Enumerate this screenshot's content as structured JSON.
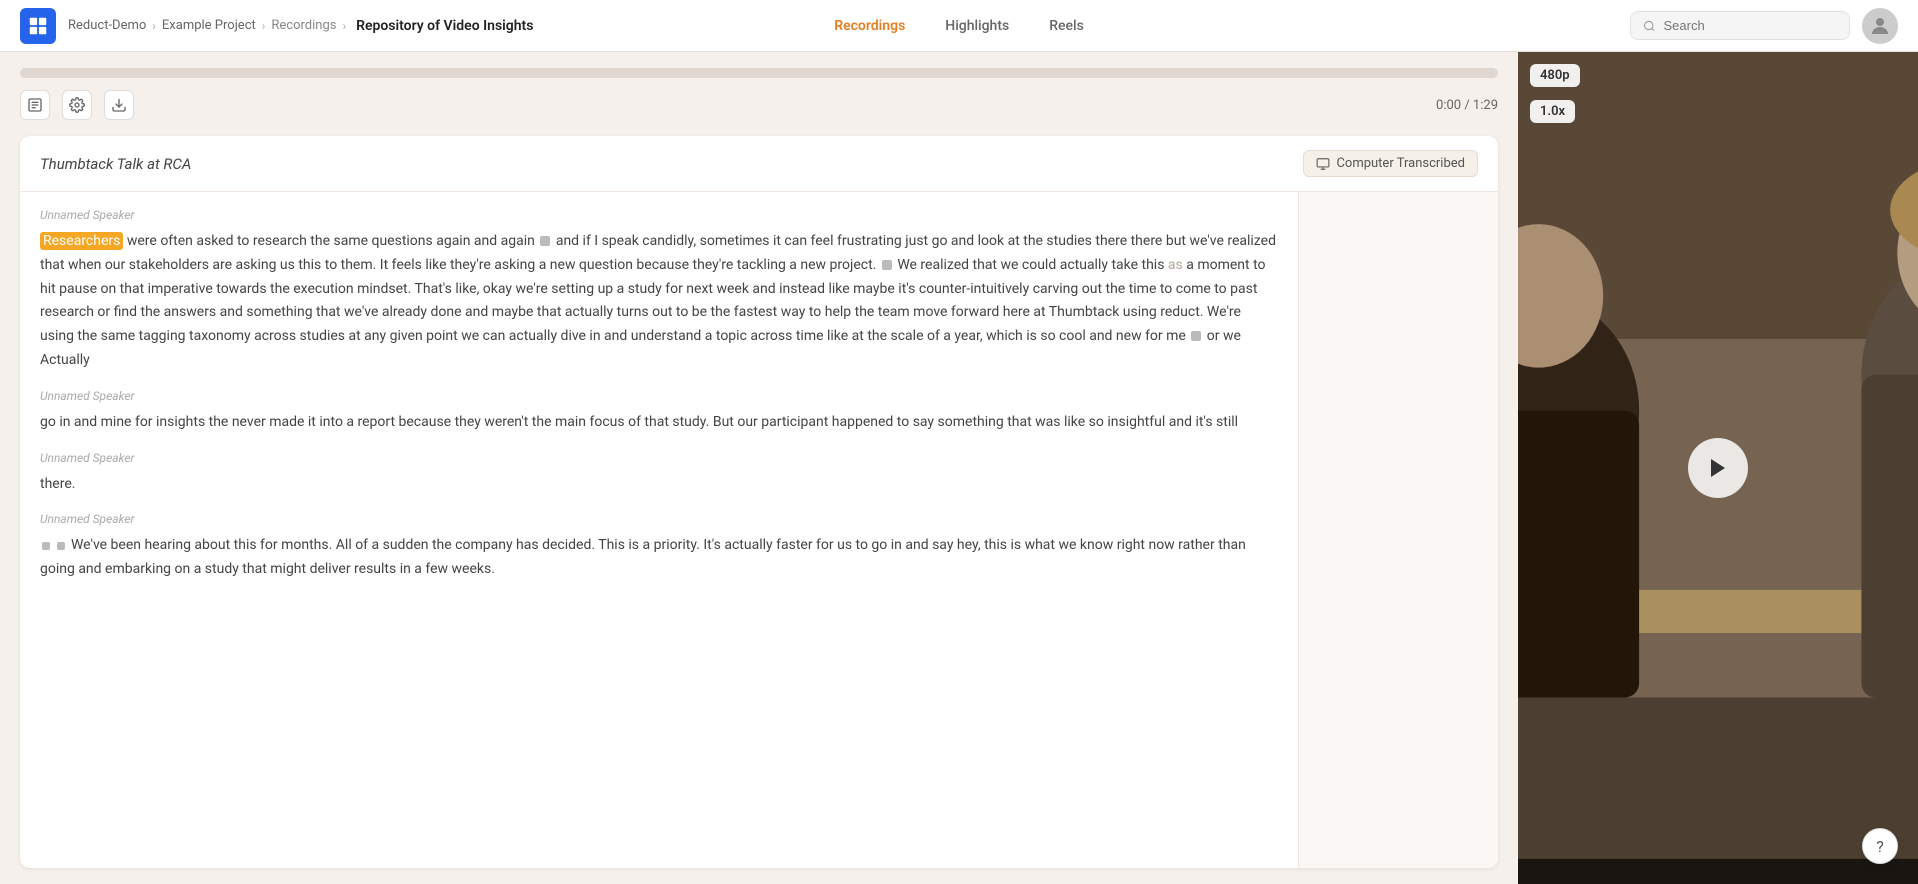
{
  "app": {
    "title": "Repository of Video Insights",
    "logo_label": "Reduct logo"
  },
  "breadcrumb": {
    "part1": "Reduct-Demo",
    "sep1": "›",
    "part2": "Example Project",
    "sep2": "›",
    "part3": "Recordings",
    "sep3": "›"
  },
  "nav": {
    "tabs": [
      {
        "label": "Recordings",
        "active": true
      },
      {
        "label": "Highlights",
        "active": false
      },
      {
        "label": "Reels",
        "active": false
      }
    ],
    "search_placeholder": "Search"
  },
  "player": {
    "current_time": "0:00",
    "total_time": "1:29",
    "time_display": "0:00 / 1:29",
    "progress_percent": 0
  },
  "transcript": {
    "title": "Thumbtack Talk at RCA",
    "badge_label": "Computer Transcribed",
    "segments": [
      {
        "speaker": "Unnamed Speaker",
        "text_parts": [
          {
            "type": "highlight",
            "text": "Researchers"
          },
          {
            "type": "normal",
            "text": " were often asked to research the same questions again and again "
          },
          {
            "type": "block"
          },
          {
            "type": "normal",
            "text": " and if I speak candidly, sometimes it can feel frustrating just go and look at the studies there there but we've realized that when our stakeholders are asking us this to them. It feels like they're asking a new question because they're tackling a new project. "
          },
          {
            "type": "block"
          },
          {
            "type": "normal",
            "text": " We realized that we could actually take this "
          },
          {
            "type": "fade",
            "text": "as"
          },
          {
            "type": "normal",
            "text": " a moment to hit pause on that imperative towards the execution mindset. That's like, okay we're setting up a study for next week and instead like maybe it's counter-intuitively carving out the time to come to past research or find the answers and something that we've already done and maybe that actually turns out to be the fastest way to help the team move forward here at Thumbtack using reduct. We're using the same tagging taxonomy across studies at any given point we can actually dive in and understand a topic across time like at the scale of a year, which is so cool and new for me "
          },
          {
            "type": "block"
          },
          {
            "type": "normal",
            "text": " or we Actually"
          }
        ]
      },
      {
        "speaker": "Unnamed Speaker",
        "text_parts": [
          {
            "type": "normal",
            "text": "go in and mine for insights the never made it into a report because they weren't the main focus of that study. But our participant happened to say something that was like so insightful and it's still"
          }
        ]
      },
      {
        "speaker": "Unnamed Speaker",
        "text_parts": [
          {
            "type": "normal",
            "text": "there."
          }
        ]
      },
      {
        "speaker": "Unnamed Speaker",
        "text_parts": [
          {
            "type": "block"
          },
          {
            "type": "block_small"
          },
          {
            "type": "normal",
            "text": " We've been hearing about this for months. All of a sudden the company has decided. This is a priority. It's actually faster for us to go in and say hey, this is what we know right now rather than going and embarking on a study that might deliver results in a few weeks."
          }
        ]
      }
    ]
  },
  "video": {
    "quality": "480p",
    "speed": "1.0x"
  },
  "help": {
    "label": "?"
  }
}
